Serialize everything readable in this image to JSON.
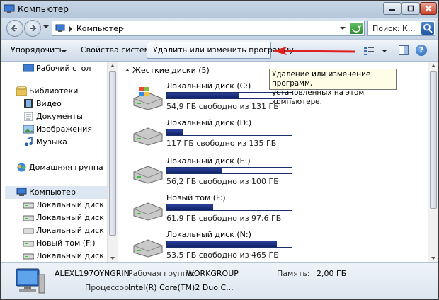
{
  "window": {
    "title": "Компьютер"
  },
  "address": {
    "crumb": "Компьютер",
    "search_placeholder": "Поиск: К..."
  },
  "toolbar": {
    "organize": "Упорядочить",
    "system_properties": "Свойства системы",
    "uninstall": "Удалить или изменить программу",
    "help": "?"
  },
  "tooltip": {
    "line1": "Удаление или изменение программ,",
    "line2": "установленных на этом компьютере."
  },
  "nav": {
    "desktop": "Рабочий стол",
    "libraries": "Библиотеки",
    "video": "Видео",
    "documents": "Документы",
    "images": "Изображения",
    "music": "Музыка",
    "homegroup": "Домашняя группа",
    "computer": "Компьютер",
    "drives": [
      "Локальный диск (C:)",
      "Локальный диск (D:)",
      "Локальный диск (E:)",
      "Новый том (F:)",
      "Локальный диск (N:)"
    ]
  },
  "content": {
    "group_header": "Жесткие диски (5)",
    "drives": [
      {
        "name": "Локальный диск (C:)",
        "free": "54,9 ГБ свободно из 131 ГБ",
        "used_fraction": 0.58
      },
      {
        "name": "Локальный диск (D:)",
        "free": "117 ГБ свободно из 135 ГБ",
        "used_fraction": 0.13
      },
      {
        "name": "Локальный диск (E:)",
        "free": "56,2 ГБ свободно из 100 ГБ",
        "used_fraction": 0.44
      },
      {
        "name": "Новый том (F:)",
        "free": "61,9 ГБ свободно из 97,6 ГБ",
        "used_fraction": 0.37
      },
      {
        "name": "Локальный диск (N:)",
        "free": "53,5 ГБ свободно из 465 ГБ",
        "used_fraction": 0.88
      }
    ]
  },
  "details": {
    "computer_name": "ALEXL197OYNGRIN",
    "workgroup_label": "Рабочая группа:",
    "workgroup_value": "WORKGROUP",
    "memory_label": "Память:",
    "memory_value": "2,00 ГБ",
    "cpu_label": "Процессор:",
    "cpu_value": "Intel(R) Core(TM)2 Duo C..."
  },
  "colors": {
    "annotation_arrow": "#e02020",
    "progress_bar": "#1a2f80"
  }
}
